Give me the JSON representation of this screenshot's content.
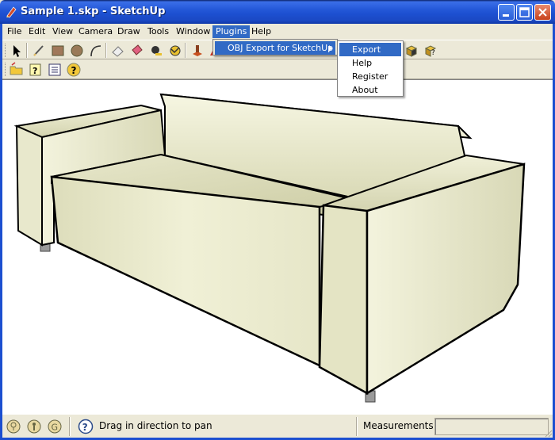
{
  "window": {
    "title": "Sample 1.skp - SketchUp",
    "app_icon": "sketchup-pencil-icon",
    "controls": [
      "minimize",
      "maximize",
      "close"
    ]
  },
  "menubar": {
    "items": [
      {
        "label": "File"
      },
      {
        "label": "Edit"
      },
      {
        "label": "View"
      },
      {
        "label": "Camera"
      },
      {
        "label": "Draw"
      },
      {
        "label": "Tools"
      },
      {
        "label": "Window"
      },
      {
        "label": "Plugins",
        "active": true
      },
      {
        "label": "Help"
      }
    ]
  },
  "plugins_menu": {
    "items": [
      {
        "label": "OBJ Export for SketchUp",
        "has_submenu": true,
        "highlighted": true
      }
    ]
  },
  "obj_submenu": {
    "items": [
      {
        "label": "Export",
        "highlighted": true
      },
      {
        "label": "Help"
      },
      {
        "label": "Register"
      },
      {
        "label": "About"
      }
    ]
  },
  "toolbar1": {
    "icons": [
      "select-arrow-icon",
      "line-pencil-icon",
      "rectangle-icon",
      "circle-icon",
      "arc-icon",
      "eraser-icon",
      "paint-bucket-icon",
      "tape-measure-icon",
      "orbit-icon",
      "push-pull-icon",
      "move-icon",
      "plugin-export-icon",
      "plugin-help-icon"
    ]
  },
  "toolbar2": {
    "icons": [
      "folder-open-icon",
      "instructor-icon",
      "outliner-icon",
      "help-icon"
    ]
  },
  "viewport": {
    "background": "#ffffff",
    "model": "sofa",
    "model_color": "#e6e6c8"
  },
  "statusbar": {
    "icons": [
      "geo-location-icon",
      "credits-icon",
      "google-icon",
      "question-icon"
    ],
    "message": "Drag in direction to pan",
    "measurements_label": "Measurements",
    "measurements_value": ""
  }
}
